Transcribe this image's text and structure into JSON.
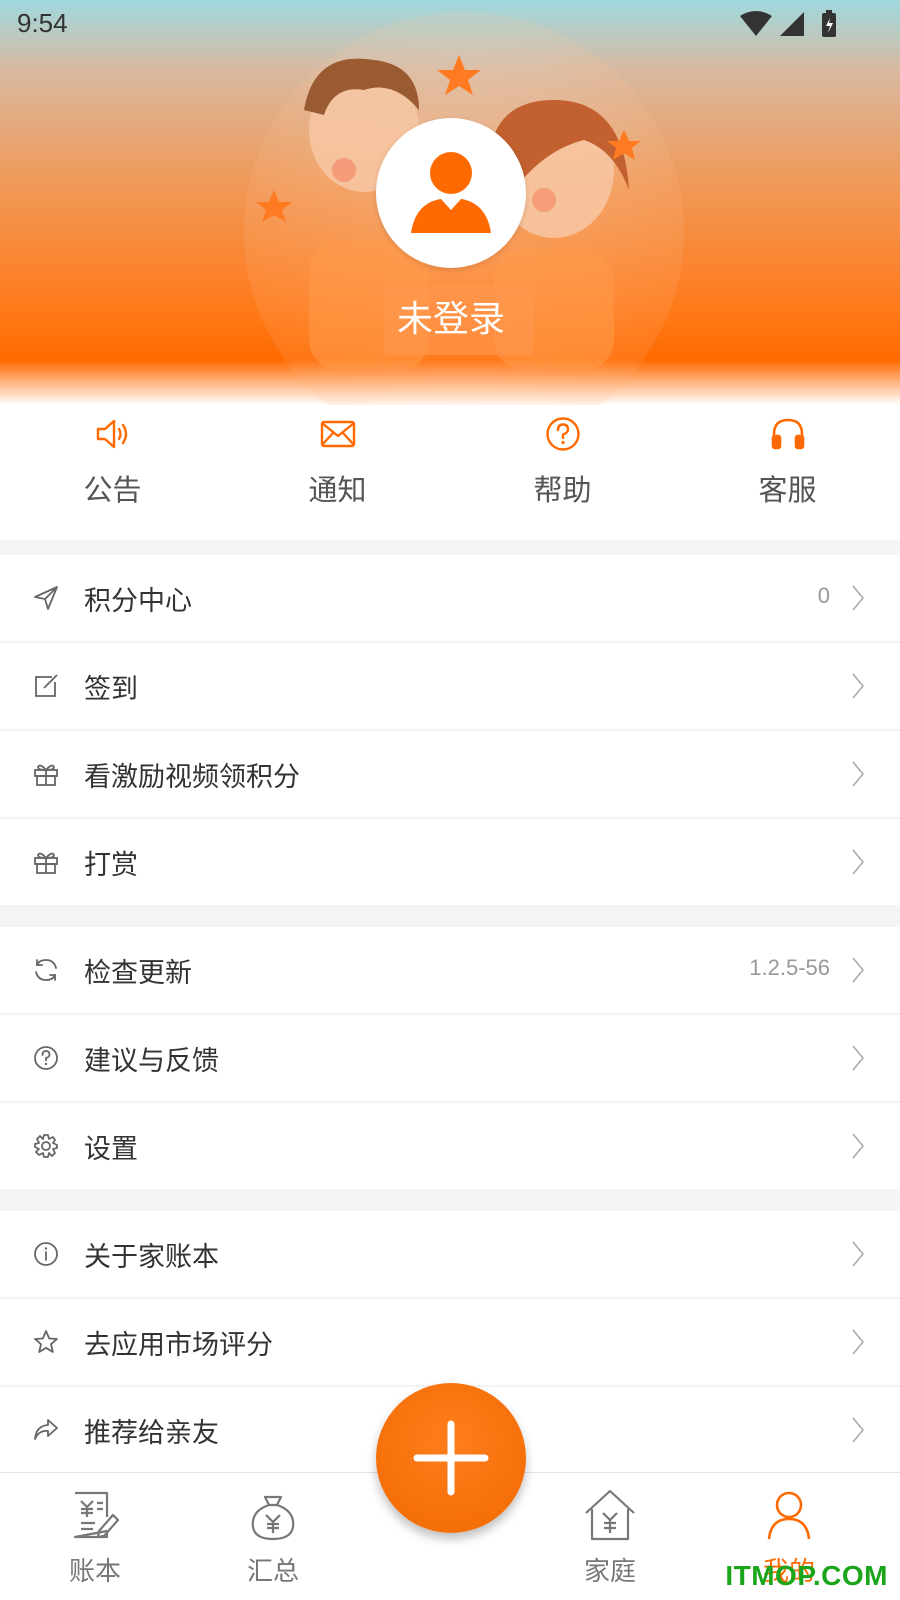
{
  "status_bar": {
    "time": "9:54"
  },
  "profile": {
    "login_text": "未登录"
  },
  "quick_actions": [
    {
      "label": "公告",
      "icon": "speaker-icon"
    },
    {
      "label": "通知",
      "icon": "mail-icon"
    },
    {
      "label": "帮助",
      "icon": "help-icon"
    },
    {
      "label": "客服",
      "icon": "headset-icon"
    }
  ],
  "menu": {
    "points_center": {
      "label": "积分中心",
      "value": "0",
      "icon": "send-icon"
    },
    "checkin": {
      "label": "签到",
      "icon": "edit-icon"
    },
    "reward_video": {
      "label": "看激励视频领积分",
      "icon": "gift-icon"
    },
    "tip": {
      "label": "打赏",
      "icon": "gift-icon"
    },
    "check_update": {
      "label": "检查更新",
      "value": "1.2.5-56",
      "icon": "refresh-icon"
    },
    "feedback": {
      "label": "建议与反馈",
      "icon": "question-icon"
    },
    "settings": {
      "label": "设置",
      "icon": "gear-icon"
    },
    "about": {
      "label": "关于家账本",
      "icon": "info-icon"
    },
    "rate": {
      "label": "去应用市场评分",
      "icon": "star-icon"
    },
    "share": {
      "label": "推荐给亲友",
      "icon": "share-icon"
    }
  },
  "tabs": [
    {
      "label": "账本",
      "icon": "ledger-icon"
    },
    {
      "label": "汇总",
      "icon": "money-bag-icon"
    },
    {
      "label": "家庭",
      "icon": "house-icon"
    },
    {
      "label": "我的",
      "icon": "person-icon"
    }
  ],
  "colors": {
    "accent": "#ff6a00",
    "text": "#333333",
    "muted": "#999999"
  },
  "watermark": "ITMOP.COM"
}
